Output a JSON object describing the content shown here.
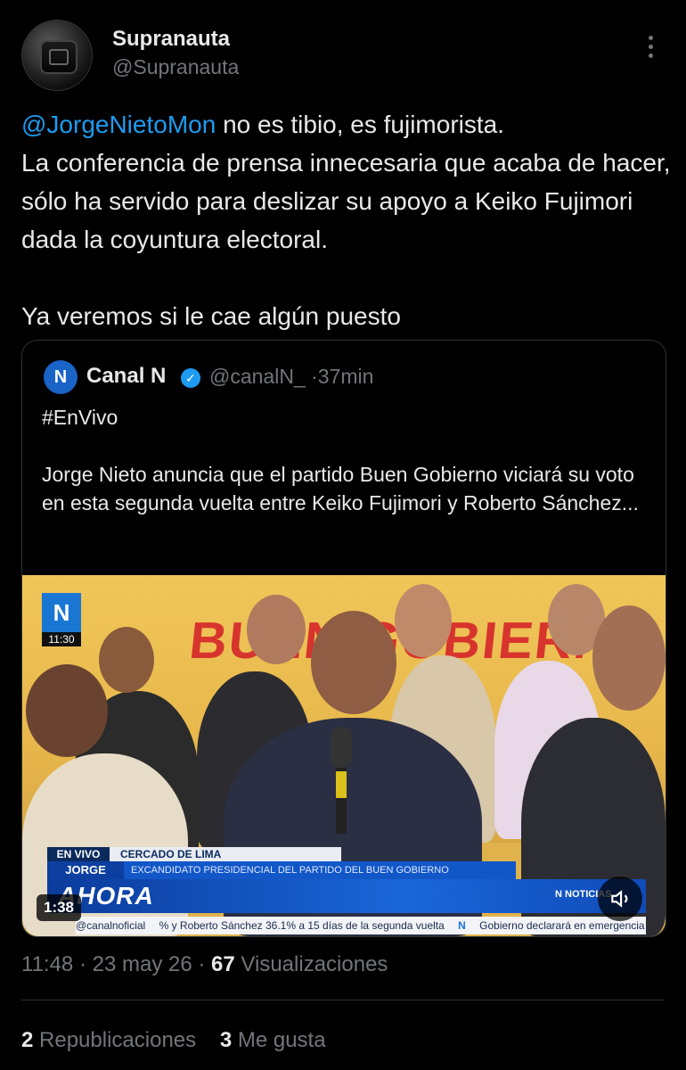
{
  "author": {
    "display_name": "Supranauta",
    "handle": "@Supranauta"
  },
  "tweet": {
    "mention": "@JorgeNietoMon",
    "line1_rest": " no es tibio, es fujimorista.",
    "line2": "La conferencia de prensa innecesaria que acaba de hacer, sólo ha servido para deslizar su apoyo a Keiko Fujimori dada la coyuntura electoral.",
    "line3": "Ya veremos si le cae algún puesto"
  },
  "quote": {
    "logo_text": "N",
    "name": "Canal N",
    "handle": "@canalN_",
    "separator": "·",
    "time": "37min",
    "hashtag": "#EnVivo",
    "body": "Jorge Nieto anuncia que el partido Buen Gobierno viciará su voto en esta segunda vuelta entre Keiko Fujimori y Roberto Sánchez..."
  },
  "video": {
    "banner_partial": "BUEN GOBIERNO",
    "channel_logo": "N",
    "clock": "11:30",
    "lower_third": {
      "live": "EN VIVO",
      "place": "CERCADO DE LIMA",
      "name": "JORGE NIETO",
      "role": "EXCANDIDATO PRESIDENCIAL DEL PARTIDO DEL BUEN GOBIERNO",
      "ahora": "AHORA",
      "noticias": "N NOTICIAS",
      "ticker_handle": "@canalnoficial",
      "ticker_1": "% y Roberto Sánchez 36.1% a 15 días de la segunda vuelta",
      "ticker_logo": "N",
      "ticker_2": "Gobierno declarará en emergencia"
    },
    "duration": "1:38",
    "volume_icon": "speaker-muted-icon"
  },
  "footer": {
    "time": "11:48",
    "date": "23 may 26",
    "views_count": "67",
    "views_label": "Visualizaciones",
    "dot": "·",
    "reposts_count": "2",
    "reposts_label": "Republicaciones",
    "likes_count": "3",
    "likes_label": "Me gusta"
  },
  "colors": {
    "background": "#000000",
    "text": "#e7e9ea",
    "secondary": "#71767b",
    "link": "#1d9bf0",
    "border": "#2f3336"
  }
}
